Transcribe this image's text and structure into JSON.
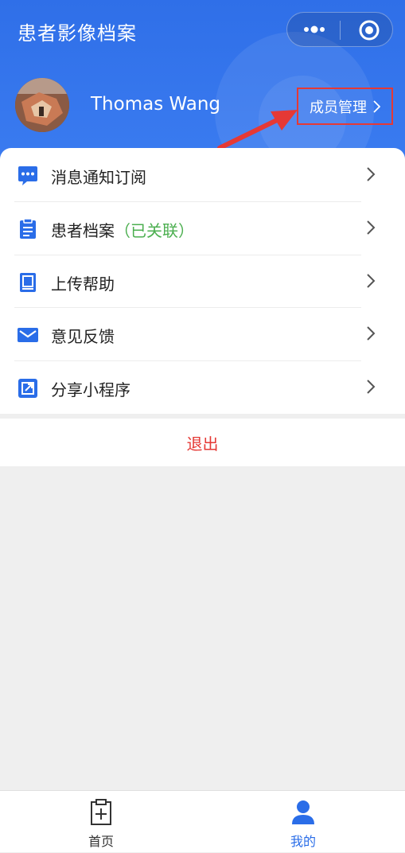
{
  "header": {
    "title": "患者影像档案",
    "user_name": "Thomas Wang",
    "member_button": "成员管理"
  },
  "menu": {
    "items": [
      {
        "label": "消息通知订阅",
        "icon": "message-icon"
      },
      {
        "label": "患者档案",
        "linked": "（已关联）",
        "icon": "clipboard-icon"
      },
      {
        "label": "上传帮助",
        "icon": "book-icon"
      },
      {
        "label": "意见反馈",
        "icon": "mail-icon"
      },
      {
        "label": "分享小程序",
        "icon": "share-icon"
      }
    ]
  },
  "logout": "退出",
  "tabbar": {
    "home": "首页",
    "mine": "我的"
  },
  "colors": {
    "header_blue": "#2f6fe8",
    "icon_blue": "#2a6de8",
    "linked_green": "#4caf50",
    "logout_red": "#e53935",
    "tab_active": "#2a6de8",
    "tab_inactive": "#333333"
  }
}
